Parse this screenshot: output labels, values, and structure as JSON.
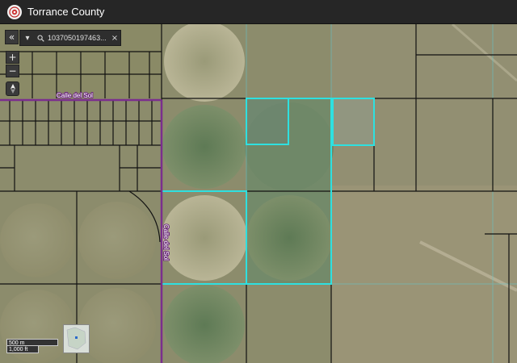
{
  "header": {
    "title": "Torrance County"
  },
  "search": {
    "value": "1037050197463...",
    "back_icon": "double-chevron-left-icon",
    "dropdown_icon": "chevron-down-icon",
    "search_icon": "search-icon",
    "clear_icon": "close-icon"
  },
  "map_controls": {
    "zoom_in": "+",
    "zoom_out": "−",
    "compass_icon": "compass-icon"
  },
  "roads": {
    "horizontal": "Calle del Sol",
    "vertical": "Calle del Sol"
  },
  "scale": {
    "metric": "500 m",
    "imperial": "1,000 ft"
  },
  "colors": {
    "road": "#7a2e8e",
    "selected_parcel": "#2ee0e0",
    "parcel_line": "#111111",
    "header_bg": "#262626",
    "terrain": "#8a8a6a"
  }
}
